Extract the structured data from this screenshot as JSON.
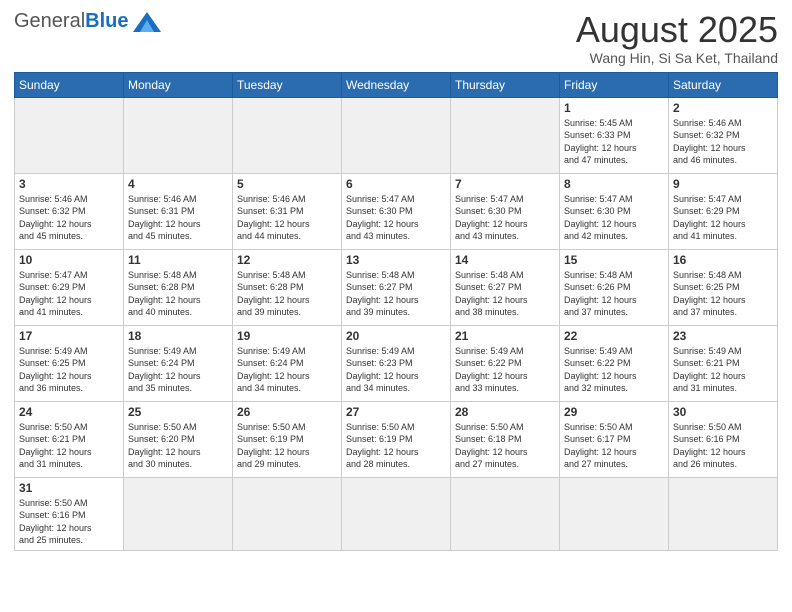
{
  "logo": {
    "general": "General",
    "blue": "Blue"
  },
  "header": {
    "month_title": "August 2025",
    "subtitle": "Wang Hin, Si Sa Ket, Thailand"
  },
  "weekdays": [
    "Sunday",
    "Monday",
    "Tuesday",
    "Wednesday",
    "Thursday",
    "Friday",
    "Saturday"
  ],
  "weeks": [
    [
      {
        "day": "",
        "info": ""
      },
      {
        "day": "",
        "info": ""
      },
      {
        "day": "",
        "info": ""
      },
      {
        "day": "",
        "info": ""
      },
      {
        "day": "",
        "info": ""
      },
      {
        "day": "1",
        "info": "Sunrise: 5:45 AM\nSunset: 6:33 PM\nDaylight: 12 hours\nand 47 minutes."
      },
      {
        "day": "2",
        "info": "Sunrise: 5:46 AM\nSunset: 6:32 PM\nDaylight: 12 hours\nand 46 minutes."
      }
    ],
    [
      {
        "day": "3",
        "info": "Sunrise: 5:46 AM\nSunset: 6:32 PM\nDaylight: 12 hours\nand 45 minutes."
      },
      {
        "day": "4",
        "info": "Sunrise: 5:46 AM\nSunset: 6:31 PM\nDaylight: 12 hours\nand 45 minutes."
      },
      {
        "day": "5",
        "info": "Sunrise: 5:46 AM\nSunset: 6:31 PM\nDaylight: 12 hours\nand 44 minutes."
      },
      {
        "day": "6",
        "info": "Sunrise: 5:47 AM\nSunset: 6:30 PM\nDaylight: 12 hours\nand 43 minutes."
      },
      {
        "day": "7",
        "info": "Sunrise: 5:47 AM\nSunset: 6:30 PM\nDaylight: 12 hours\nand 43 minutes."
      },
      {
        "day": "8",
        "info": "Sunrise: 5:47 AM\nSunset: 6:30 PM\nDaylight: 12 hours\nand 42 minutes."
      },
      {
        "day": "9",
        "info": "Sunrise: 5:47 AM\nSunset: 6:29 PM\nDaylight: 12 hours\nand 41 minutes."
      }
    ],
    [
      {
        "day": "10",
        "info": "Sunrise: 5:47 AM\nSunset: 6:29 PM\nDaylight: 12 hours\nand 41 minutes."
      },
      {
        "day": "11",
        "info": "Sunrise: 5:48 AM\nSunset: 6:28 PM\nDaylight: 12 hours\nand 40 minutes."
      },
      {
        "day": "12",
        "info": "Sunrise: 5:48 AM\nSunset: 6:28 PM\nDaylight: 12 hours\nand 39 minutes."
      },
      {
        "day": "13",
        "info": "Sunrise: 5:48 AM\nSunset: 6:27 PM\nDaylight: 12 hours\nand 39 minutes."
      },
      {
        "day": "14",
        "info": "Sunrise: 5:48 AM\nSunset: 6:27 PM\nDaylight: 12 hours\nand 38 minutes."
      },
      {
        "day": "15",
        "info": "Sunrise: 5:48 AM\nSunset: 6:26 PM\nDaylight: 12 hours\nand 37 minutes."
      },
      {
        "day": "16",
        "info": "Sunrise: 5:48 AM\nSunset: 6:25 PM\nDaylight: 12 hours\nand 37 minutes."
      }
    ],
    [
      {
        "day": "17",
        "info": "Sunrise: 5:49 AM\nSunset: 6:25 PM\nDaylight: 12 hours\nand 36 minutes."
      },
      {
        "day": "18",
        "info": "Sunrise: 5:49 AM\nSunset: 6:24 PM\nDaylight: 12 hours\nand 35 minutes."
      },
      {
        "day": "19",
        "info": "Sunrise: 5:49 AM\nSunset: 6:24 PM\nDaylight: 12 hours\nand 34 minutes."
      },
      {
        "day": "20",
        "info": "Sunrise: 5:49 AM\nSunset: 6:23 PM\nDaylight: 12 hours\nand 34 minutes."
      },
      {
        "day": "21",
        "info": "Sunrise: 5:49 AM\nSunset: 6:22 PM\nDaylight: 12 hours\nand 33 minutes."
      },
      {
        "day": "22",
        "info": "Sunrise: 5:49 AM\nSunset: 6:22 PM\nDaylight: 12 hours\nand 32 minutes."
      },
      {
        "day": "23",
        "info": "Sunrise: 5:49 AM\nSunset: 6:21 PM\nDaylight: 12 hours\nand 31 minutes."
      }
    ],
    [
      {
        "day": "24",
        "info": "Sunrise: 5:50 AM\nSunset: 6:21 PM\nDaylight: 12 hours\nand 31 minutes."
      },
      {
        "day": "25",
        "info": "Sunrise: 5:50 AM\nSunset: 6:20 PM\nDaylight: 12 hours\nand 30 minutes."
      },
      {
        "day": "26",
        "info": "Sunrise: 5:50 AM\nSunset: 6:19 PM\nDaylight: 12 hours\nand 29 minutes."
      },
      {
        "day": "27",
        "info": "Sunrise: 5:50 AM\nSunset: 6:19 PM\nDaylight: 12 hours\nand 28 minutes."
      },
      {
        "day": "28",
        "info": "Sunrise: 5:50 AM\nSunset: 6:18 PM\nDaylight: 12 hours\nand 27 minutes."
      },
      {
        "day": "29",
        "info": "Sunrise: 5:50 AM\nSunset: 6:17 PM\nDaylight: 12 hours\nand 27 minutes."
      },
      {
        "day": "30",
        "info": "Sunrise: 5:50 AM\nSunset: 6:16 PM\nDaylight: 12 hours\nand 26 minutes."
      }
    ],
    [
      {
        "day": "31",
        "info": "Sunrise: 5:50 AM\nSunset: 6:16 PM\nDaylight: 12 hours\nand 25 minutes."
      },
      {
        "day": "",
        "info": ""
      },
      {
        "day": "",
        "info": ""
      },
      {
        "day": "",
        "info": ""
      },
      {
        "day": "",
        "info": ""
      },
      {
        "day": "",
        "info": ""
      },
      {
        "day": "",
        "info": ""
      }
    ]
  ]
}
